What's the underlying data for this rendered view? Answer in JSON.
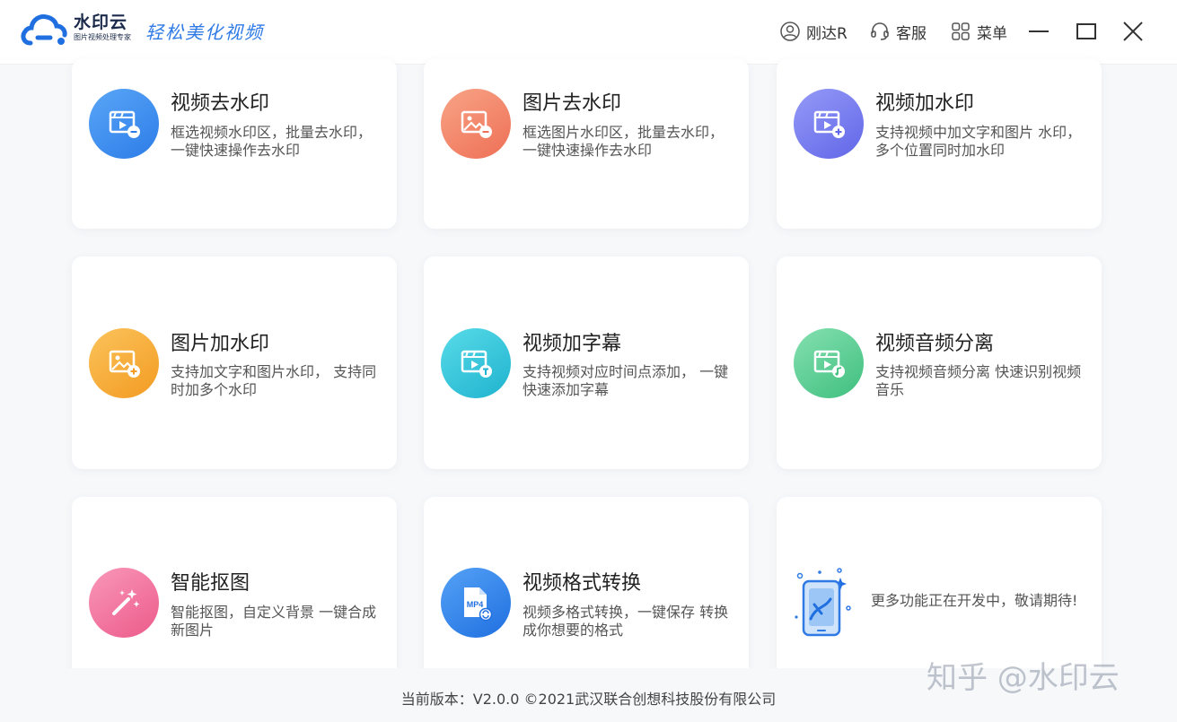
{
  "header": {
    "brand_name": "水印云",
    "brand_sub": "图片视频处理专家",
    "slogan": "轻松美化视频",
    "user_label": "刚达R",
    "service_label": "客服",
    "menu_label": "菜单"
  },
  "cards": [
    {
      "title": "视频去水印",
      "desc": "框选视频水印区，批量去水印， 一键快速操作去水印",
      "color": "#3d8ef0"
    },
    {
      "title": "图片去水印",
      "desc": "框选图片水印区，批量去水印， 一键快速操作去水印",
      "color": "#f3876a"
    },
    {
      "title": "视频加水印",
      "desc": "支持视频中加文字和图片 水印，多个位置同时加水印",
      "color": "#7a7ef2"
    },
    {
      "title": "图片加水印",
      "desc": "支持加文字和图片水印， 支持同时加多个水印",
      "color": "#f7ac3a"
    },
    {
      "title": "视频加字幕",
      "desc": "支持视频对应时间点添加， 一键快速添加字幕",
      "color": "#2fc6d8"
    },
    {
      "title": "视频音频分离",
      "desc": "支持视频音频分离 快速识别视频音乐",
      "color": "#5ccf95"
    },
    {
      "title": "智能抠图",
      "desc": "智能抠图，自定义背景 一键合成新图片",
      "color": "#f4709a"
    },
    {
      "title": "视频格式转换",
      "desc": "视频多格式转换，一键保存 转换成你想要的格式",
      "color": "#2f82ea"
    }
  ],
  "more": {
    "text": "更多功能正在开发中，敬请期待!"
  },
  "icons": {
    "mp4": "MP4"
  },
  "footer": {
    "version": "当前版本：V2.0.0 ©2021武汉联合创想科技股份有限公司"
  },
  "watermark": "知乎 @水印云"
}
